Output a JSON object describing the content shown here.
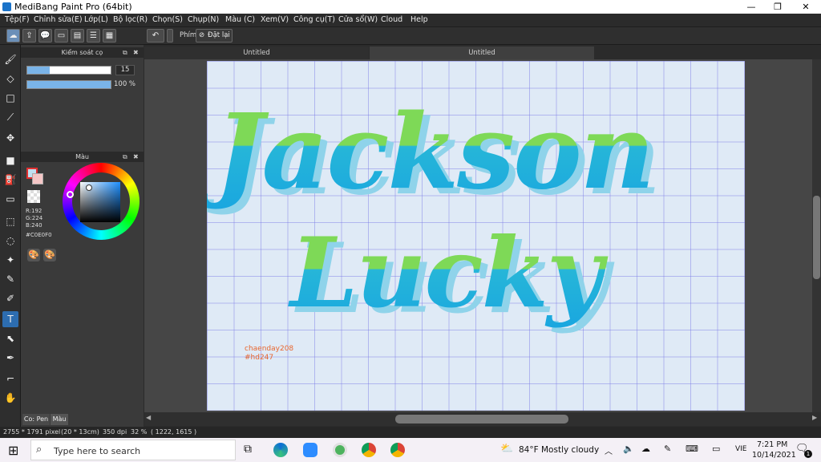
{
  "window": {
    "title": "MediBang Paint Pro (64bit)",
    "minimize": "—",
    "maximize": "❐",
    "close": "✕"
  },
  "menu": [
    "Tệp(F)",
    "Chỉnh sửa(E)",
    "Lớp(L)",
    "Bộ lọc(R)",
    "Chọn(S)",
    "Chụp(N)",
    "Màu (C)",
    "Xem(V)",
    "Công cụ(T)",
    "Cửa sổ(W)",
    "Cloud",
    "Help"
  ],
  "toolbar": {
    "key_label": "Phím",
    "reset_label": "Đặt lại"
  },
  "brush_panel": {
    "title": "Kiểm soát cọ",
    "size_value": "15",
    "opacity_value": "100 %",
    "size_fraction": 0.27,
    "opacity_fraction": 1.0
  },
  "color_panel": {
    "title": "Màu",
    "r": "R:192",
    "g": "G:224",
    "b": "B:240",
    "hex": "#C0E0F0",
    "color": "#c0e0f0"
  },
  "panel_tabs": {
    "brush": "Co: Pen",
    "color": "Màu"
  },
  "tabs": [
    "Untitled",
    "Untitled"
  ],
  "artwork": {
    "line1": "Jackson",
    "line2": "Lucky",
    "credit1": "chaenday208",
    "credit2": "#hd247"
  },
  "status": {
    "size": "2755 * 1791 pixel",
    "cm": "(20 * 13cm)",
    "dpi": "350 dpi",
    "zoom": "32 %",
    "coords": "( 1222, 1615 )"
  },
  "taskbar": {
    "search_placeholder": "Type here to search",
    "temp": "84°F",
    "weather": "Mostly cloudy",
    "lang": "VIE",
    "time": "7:21 PM",
    "date": "10/14/2021",
    "notif": "1"
  }
}
